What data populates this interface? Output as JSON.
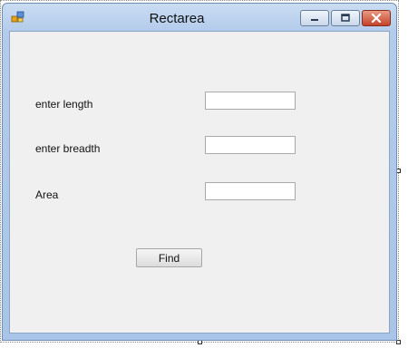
{
  "window": {
    "title": "Rectarea",
    "icon": "form-icon",
    "controls": [
      "minimize-icon",
      "maximize-icon",
      "close-icon"
    ]
  },
  "form": {
    "length_label": "enter length",
    "length_value": "",
    "breadth_label": "enter breadth",
    "breadth_value": "",
    "area_label": "Area",
    "area_value": "",
    "find_button": "Find"
  },
  "colors": {
    "client_bg": "#f0f0f0",
    "close_button": "#c4432a",
    "frame": "#b4cceb"
  }
}
